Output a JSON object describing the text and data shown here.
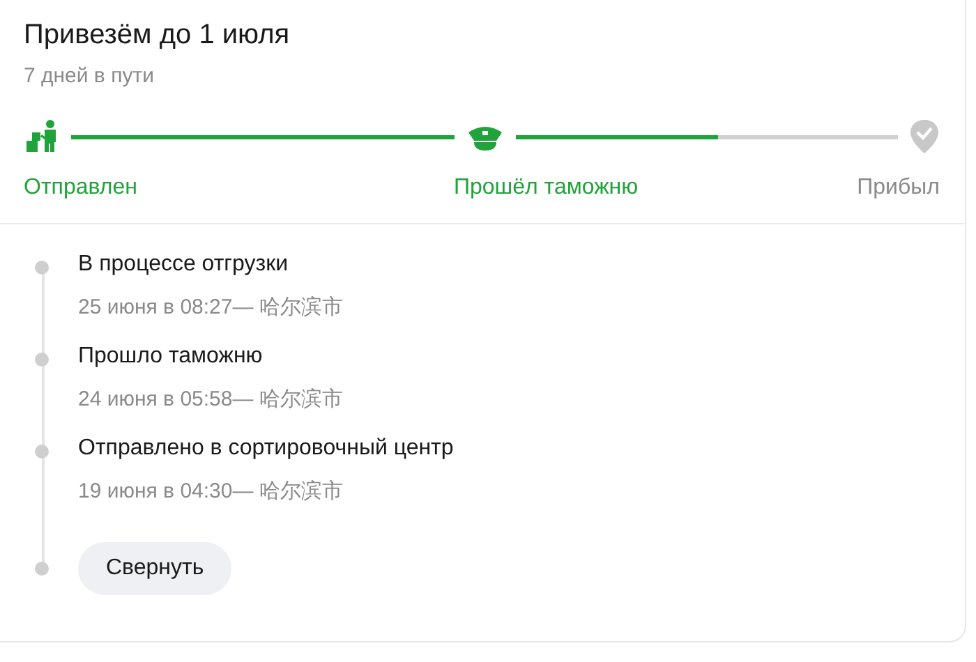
{
  "title": "Привезём до 1 июля",
  "subtitle": "7 дней в пути",
  "stages": [
    {
      "kind": "shipped",
      "label": "Отправлен",
      "reached": true
    },
    {
      "kind": "customs",
      "label": "Прошёл таможню",
      "reached": true
    },
    {
      "kind": "arrived",
      "label": "Прибыл",
      "reached": false
    }
  ],
  "segments": [
    {
      "level": 1
    },
    {
      "level": 0.53
    }
  ],
  "events": [
    {
      "status": "В процессе отгрузки",
      "time": "25 июня в 08:27— 哈尔滨市"
    },
    {
      "status": "Прошло таможню",
      "time": "24 июня в 05:58— 哈尔滨市"
    },
    {
      "status": "Отправлено в сортировочный центр",
      "time": "19 июня в 04:30— 哈尔滨市"
    }
  ],
  "collapse_button": "Свернуть"
}
